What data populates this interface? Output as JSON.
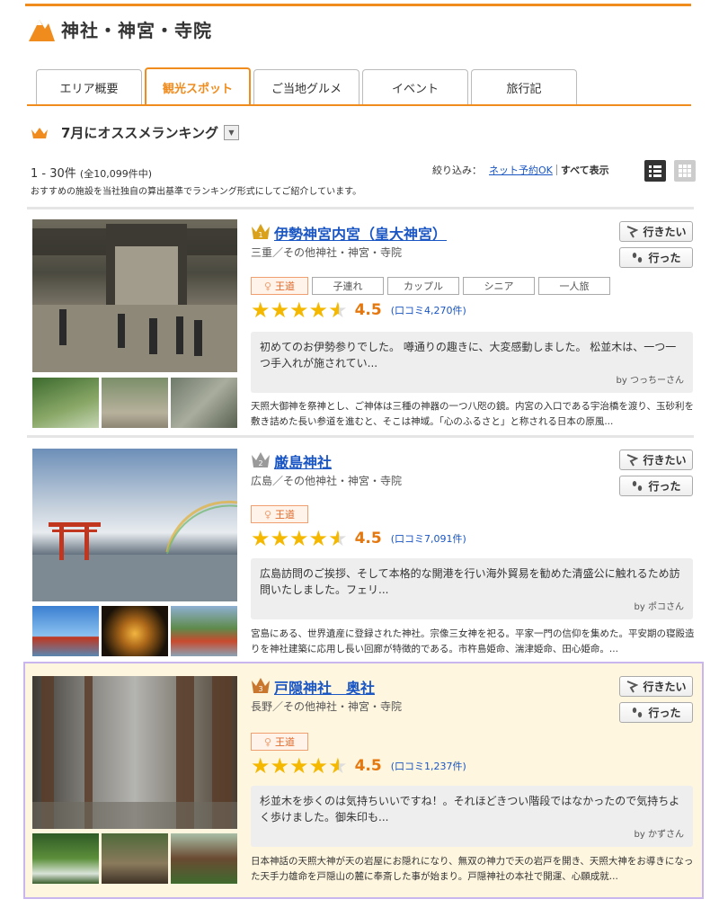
{
  "header": {
    "title": "神社・神宮・寺院"
  },
  "tabs": [
    {
      "label": "エリア概要"
    },
    {
      "label": "観光スポット"
    },
    {
      "label": "ご当地グルメ"
    },
    {
      "label": "イベント"
    },
    {
      "label": "旅行記"
    }
  ],
  "ranking": {
    "title": "7月にオススメランキング"
  },
  "listing": {
    "range": "1 - 30件",
    "total": "(全10,099件中)",
    "description": "おすすめの施設を当社独自の算出基準でランキング形式にしてご紹介しています。",
    "filter_label": "絞り込み：",
    "filter_link": "ネット予約OK",
    "filter_all": "すべて表示"
  },
  "buttons": {
    "want": "行きたい",
    "went": "行った"
  },
  "spots": [
    {
      "rank": "1",
      "name": "伊勢神宮内宮（皇大神宮）",
      "area": "三重／その他神社・神宮・寺院",
      "tags": [
        "王道",
        "子連れ",
        "カップル",
        "シニア",
        "一人旅"
      ],
      "score": "4.5",
      "reviews": "(口コミ4,270件)",
      "review_text": "初めてのお伊勢参りでした。 噂通りの趣きに、大変感動しました。 松並木は、一つ一つ手入れが施されてい...",
      "review_author": "by つっちーさん",
      "summary": "天照大御神を祭神とし、ご神体は三種の神器の一つ八咫の鏡。内宮の入口である宇治橋を渡り、玉砂利を敷き詰めた長い参道を進むと、そこは神域。「心のふるさと」と称される日本の原風..."
    },
    {
      "rank": "2",
      "name": "厳島神社",
      "area": "広島／その他神社・神宮・寺院",
      "tags": [
        "王道"
      ],
      "score": "4.5",
      "reviews": "(口コミ7,091件)",
      "review_text": "広島訪問のご挨拶、そして本格的な開港を行い海外貿易を勧めた清盛公に触れるため訪問いたしました。フェリ...",
      "review_author": "by ポコさん",
      "summary": "宮島にある、世界遺産に登録された神社。宗像三女神を祀る。平家一門の信仰を集めた。平安期の寝殿造りを神社建築に応用し長い回廊が特徴的である。市杵島姫命、湍津姫命、田心姫命。..."
    },
    {
      "rank": "3",
      "name": "戸隠神社　奥社",
      "area": "長野／その他神社・神宮・寺院",
      "tags": [
        "王道"
      ],
      "score": "4.5",
      "reviews": "(口コミ1,237件)",
      "review_text": "杉並木を歩くのは気持ちいいですね！。それほどきつい階段ではなかったので気持ちよく歩けました。御朱印も...",
      "review_author": "by かずさん",
      "summary": "日本神話の天照大神が天の岩屋にお隠れになり、無双の神力で天の岩戸を開き、天照大神をお導きになった天手力雄命を戸隠山の麓に奉斎した事が始まり。戸隠神社の本社で開運、心願成就..."
    }
  ],
  "colors": {
    "accent": "#f08c1e",
    "link": "#1a56c4",
    "star": "#f5b800",
    "score": "#e5770f",
    "highlight_bg": "#fff6df"
  }
}
